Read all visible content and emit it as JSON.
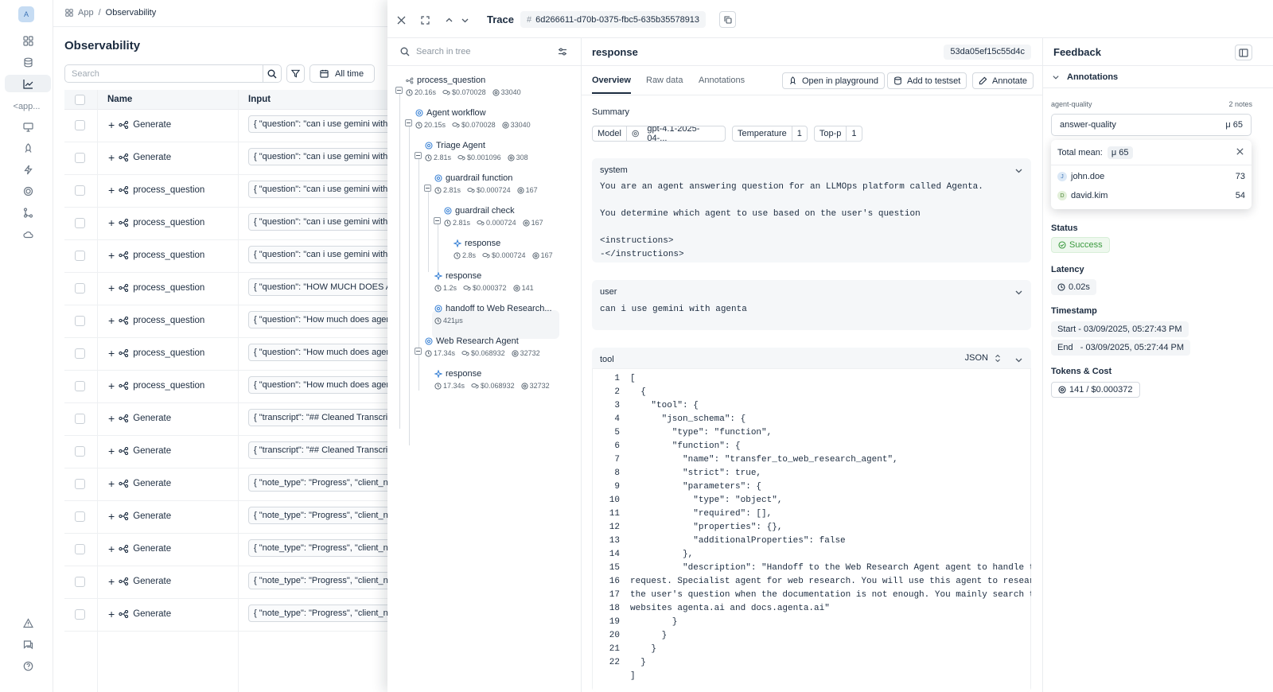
{
  "rail": {
    "logo_letter": "A",
    "app_label": "<app..."
  },
  "breadcrumb": {
    "root": "App",
    "current": "Observability"
  },
  "page": {
    "title": "Observability"
  },
  "search": {
    "placeholder": "Search"
  },
  "time_filter": "All time",
  "table": {
    "headers": {
      "name": "Name",
      "input": "Input"
    },
    "rows": [
      {
        "name": "Generate",
        "input": "{ \"question\": \"can i use gemini with agenta\" }"
      },
      {
        "name": "Generate",
        "input": "{ \"question\": \"can i use gemini with agenta\" }"
      },
      {
        "name": "process_question",
        "input": "{ \"question\": \"can i use gemini with agenta\" }"
      },
      {
        "name": "process_question",
        "input": "{ \"question\": \"can i use gemini with agenta\" }"
      },
      {
        "name": "process_question",
        "input": "{ \"question\": \"can i use gemini with agenta\" }"
      },
      {
        "name": "process_question",
        "input": "{ \"question\": \"HOW MUCH DOES AGENTA COST\" }"
      },
      {
        "name": "process_question",
        "input": "{ \"question\": \"How much does agenta cost\" }"
      },
      {
        "name": "process_question",
        "input": "{ \"question\": \"How much does agenta cost\" }"
      },
      {
        "name": "process_question",
        "input": "{ \"question\": \"How much does agenta cost\" }"
      },
      {
        "name": "Generate",
        "input": "{ \"transcript\": \"## Cleaned Transcript\" }"
      },
      {
        "name": "Generate",
        "input": "{ \"transcript\": \"## Cleaned Transcript\" }"
      },
      {
        "name": "Generate",
        "input": "{ \"note_type\": \"Progress\", \"client_name\" }"
      },
      {
        "name": "Generate",
        "input": "{ \"note_type\": \"Progress\", \"client_name\" }"
      },
      {
        "name": "Generate",
        "input": "{ \"note_type\": \"Progress\", \"client_name\" }"
      },
      {
        "name": "Generate",
        "input": "{ \"note_type\": \"Progress\", \"client_name\" }"
      },
      {
        "name": "Generate",
        "input": "{ \"note_type\": \"Progress\", \"client_name\" }"
      }
    ]
  },
  "trace": {
    "label": "Trace",
    "id": "6d266611-d70b-0375-fbc5-635b35578913"
  },
  "tree": {
    "search_placeholder": "Search in tree",
    "nodes": [
      {
        "name": "process_question",
        "latency": "20.16s",
        "cost": "$0.070028",
        "tokens": "33040"
      },
      {
        "name": "Agent workflow",
        "latency": "20.15s",
        "cost": "$0.070028",
        "tokens": "33040"
      },
      {
        "name": "Triage Agent",
        "latency": "2.81s",
        "cost": "$0.001096",
        "tokens": "308"
      },
      {
        "name": "guardrail function",
        "latency": "2.81s",
        "cost": "$0.000724",
        "tokens": "167"
      },
      {
        "name": "guardrail check",
        "latency": "2.81s",
        "cost": "0.000724",
        "tokens": "167"
      },
      {
        "name": "response",
        "latency": "2.8s",
        "cost": "$0.000724",
        "tokens": "167"
      },
      {
        "name": "response",
        "latency": "1.2s",
        "cost": "$0.000372",
        "tokens": "141"
      },
      {
        "name": "handoff to Web Research...",
        "latency": "421μs",
        "cost": "",
        "tokens": ""
      },
      {
        "name": "Web Research Agent",
        "latency": "17.34s",
        "cost": "$0.068932",
        "tokens": "32732"
      },
      {
        "name": "response",
        "latency": "17.34s",
        "cost": "$0.068932",
        "tokens": "32732"
      }
    ]
  },
  "detail": {
    "title": "response",
    "span_id": "53da05ef15c55d4c",
    "tabs": [
      "Overview",
      "Raw data",
      "Annotations"
    ],
    "actions": {
      "playground": "Open in playground",
      "testset": "Add to testset",
      "annotate": "Annotate"
    },
    "summary_label": "Summary",
    "tags": {
      "model_label": "Model",
      "model_value": "gpt-4.1-2025-04-...",
      "temp_label": "Temperature",
      "temp_value": "1",
      "topp_label": "Top-p",
      "topp_value": "1"
    },
    "system": {
      "label": "system",
      "text": "You are an agent answering question for an LLMOps platform called Agenta.\n\nYou determine which agent to use based on the user's question\n\n<instructions>\n-</instructions>"
    },
    "user": {
      "label": "user",
      "text": "can i use gemini with agenta"
    },
    "tool": {
      "label": "tool",
      "format": "JSON",
      "line_numbers": "1\n2\n3\n4\n5\n6\n7\n8\n9\n10\n11\n12\n13\n14\n15\n16\n17\n18\n19\n20\n21\n22",
      "code": "[\n  {\n    \"tool\": {\n      \"json_schema\": {\n        \"type\": \"function\",\n        \"function\": {\n          \"name\": \"transfer_to_web_research_agent\",\n          \"strict\": true,\n          \"parameters\": {\n            \"type\": \"object\",\n            \"required\": [],\n            \"properties\": {},\n            \"additionalProperties\": false\n          },\n          \"description\": \"Handoff to the Web Research Agent agent to handle the\nrequest. Specialist agent for web research. You will use this agent to research\nthe user's question when the documentation is not enough. You mainly search the\nwebsites agenta.ai and docs.agenta.ai\"\n        }\n      }\n    }\n  }\n]"
    }
  },
  "feedback": {
    "title": "Feedback",
    "annotations_label": "Annotations",
    "group_label": "agent-quality",
    "notes_count": "2 notes",
    "metric": "answer-quality",
    "metric_mean": "μ 65",
    "popup": {
      "total_label": "Total mean:",
      "total_value": "μ 65",
      "users": [
        {
          "initial": "J",
          "name": "john.doe",
          "score": "73"
        },
        {
          "initial": "D",
          "name": "david.kim",
          "score": "54"
        }
      ]
    },
    "status_label": "Status",
    "status_value": "Success",
    "latency_label": "Latency",
    "latency_value": "0.02s",
    "timestamp_label": "Timestamp",
    "start": "Start - 03/09/2025, 05:27:43 PM",
    "end": "End   - 03/09/2025, 05:27:44 PM",
    "tokens_label": "Tokens & Cost",
    "tokens_value": "141 / $0.000372"
  }
}
